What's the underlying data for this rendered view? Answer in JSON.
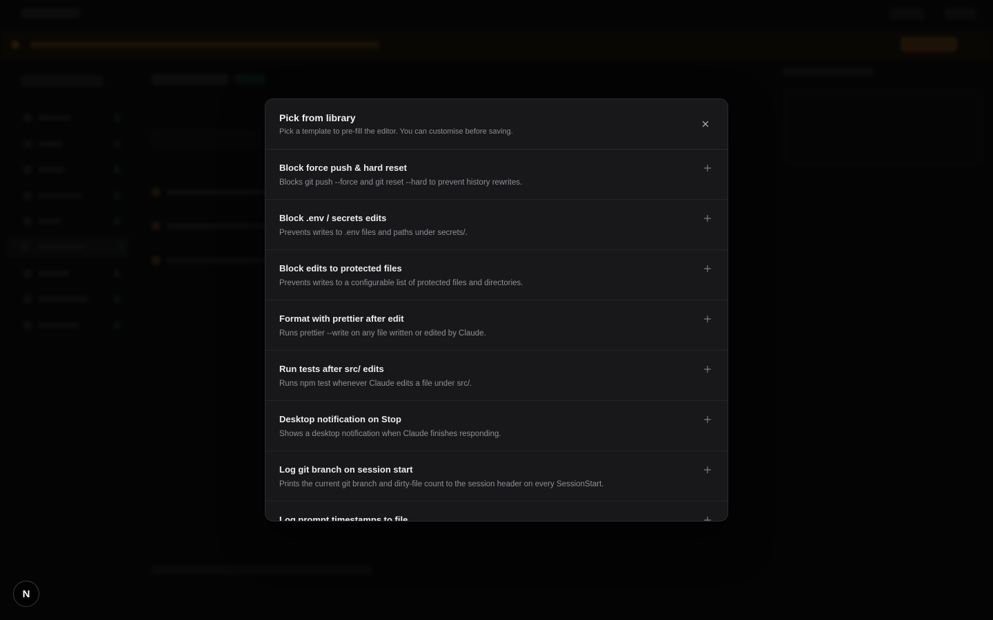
{
  "modal": {
    "title": "Pick from library",
    "subtitle": "Pick a template to pre-fill the editor. You can customise before saving.",
    "close_icon": "close-icon",
    "templates": [
      {
        "title": "Block force push & hard reset",
        "description": "Blocks git push --force and git reset --hard to prevent history rewrites."
      },
      {
        "title": "Block .env / secrets edits",
        "description": "Prevents writes to .env files and paths under secrets/."
      },
      {
        "title": "Block edits to protected files",
        "description": "Prevents writes to a configurable list of protected files and directories."
      },
      {
        "title": "Format with prettier after edit",
        "description": "Runs prettier --write on any file written or edited by Claude."
      },
      {
        "title": "Run tests after src/ edits",
        "description": "Runs npm test whenever Claude edits a file under src/."
      },
      {
        "title": "Desktop notification on Stop",
        "description": "Shows a desktop notification when Claude finishes responding."
      },
      {
        "title": "Log git branch on session start",
        "description": "Prints the current git branch and dirty-file count to the session header on every SessionStart."
      },
      {
        "title": "Log prompt timestamps to file",
        "description": ""
      }
    ]
  },
  "dev_badge": {
    "label": "N"
  },
  "colors": {
    "background": "#0b0b0c",
    "modal_bg": "#18181b",
    "border": "#2c2c30",
    "banner_accent": "#6b4810",
    "active_green": "#12361f"
  }
}
